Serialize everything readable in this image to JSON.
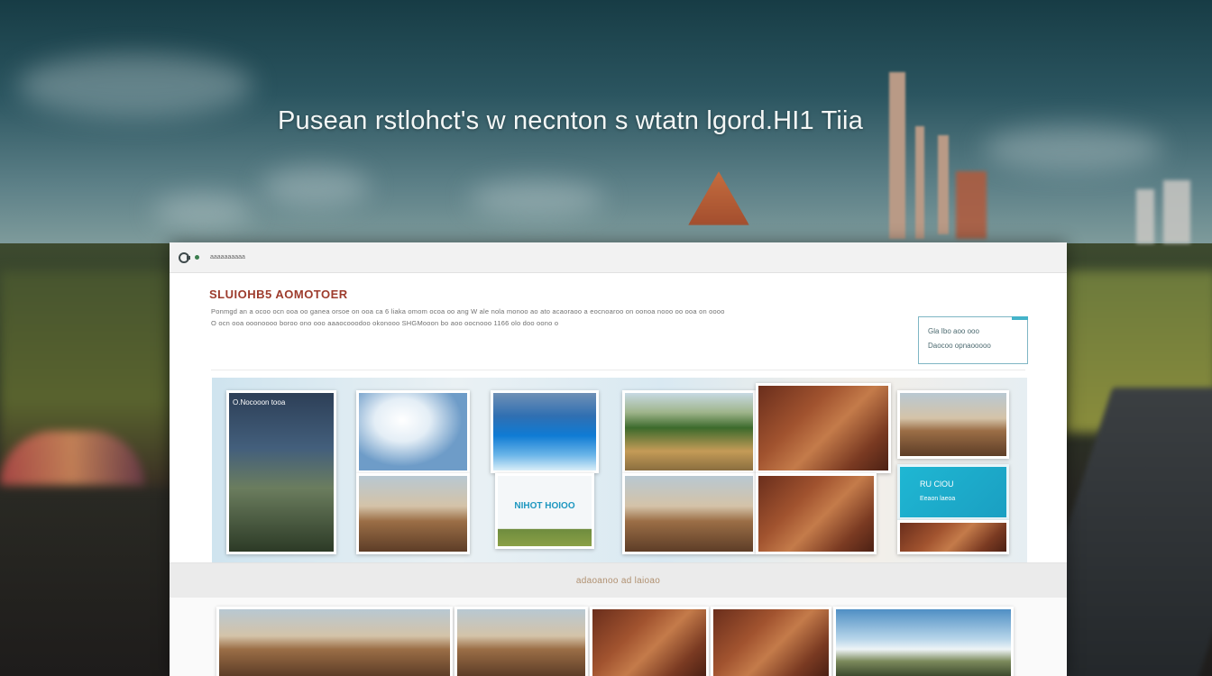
{
  "headline": "Pusean rstlohct's w necnton s wtatn lgord.HI1 Tiia",
  "browser": {
    "url": "aaaaaaaaaa"
  },
  "page": {
    "title": "SLUIOHB5 AOMOTOER",
    "description_lines": [
      "Ponmgd an a ocoo ocn ooa oo ganea orsoe on ooa ca 6 liaka omom ocoa oo ang W ale nola monoo ao ato acaoraoo a eocnoaroo on oonoa nooo oo ooa on oooo",
      "O ocn ooa ooonoooo boroo ono ooo aaaocooodoo okonooo SHGMooon bo aoo oocnooo 1166 olo doo oono o"
    ],
    "side_box": {
      "line1": "Gla Ibo aoo ooo",
      "line2": "Daocoo opnaooooo"
    },
    "gallery": {
      "tile_title": "O.Nocooon tooa",
      "center_label": "NIHOT HOIOO",
      "teal_title": "RU ClOU",
      "teal_sub": "Eeaon laeoa"
    },
    "strip_caption": "adaoanoo ad laioao"
  },
  "colors": {
    "accent_red": "#9d3b2c",
    "teal": "#1fb7d3"
  }
}
